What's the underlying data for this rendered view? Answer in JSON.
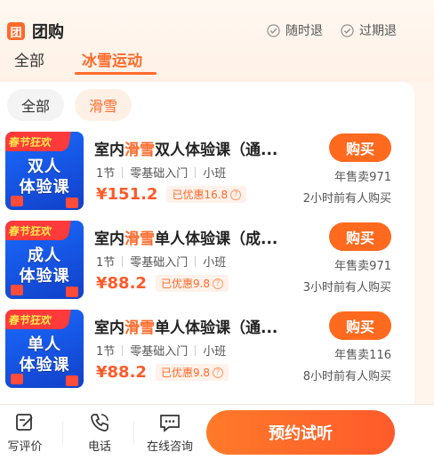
{
  "header": {
    "brand_logo": "团",
    "brand_title": "团购",
    "badges": [
      "随时退",
      "过期退"
    ]
  },
  "tabs": [
    {
      "label": "全部",
      "active": false
    },
    {
      "label": "冰雪运动",
      "active": true
    }
  ],
  "chips": [
    {
      "label": "全部",
      "active": false
    },
    {
      "label": "滑雪",
      "active": true
    }
  ],
  "products": [
    {
      "thumb_banner": "春节狂欢",
      "thumb_line1": "双人",
      "thumb_line2": "体验课",
      "title_pre": "室内",
      "title_hl": "滑雪",
      "title_post": "双人体验课（通...",
      "meta": [
        "1节",
        "零基础入门",
        "小班"
      ],
      "price": "¥151.2",
      "discount": "已优惠16.8",
      "buy_label": "购买",
      "sales": "年售卖971",
      "recent": "2小时前有人购买"
    },
    {
      "thumb_banner": "春节狂欢",
      "thumb_line1": "成人",
      "thumb_line2": "体验课",
      "title_pre": "室内",
      "title_hl": "滑雪",
      "title_post": "单人体验课（成...",
      "meta": [
        "1节",
        "零基础入门",
        "小班"
      ],
      "price": "¥88.2",
      "discount": "已优惠9.8",
      "buy_label": "购买",
      "sales": "年售卖971",
      "recent": "3小时前有人购买"
    },
    {
      "thumb_banner": "春节狂欢",
      "thumb_line1": "单人",
      "thumb_line2": "体验课",
      "title_pre": "室内",
      "title_hl": "滑雪",
      "title_post": "单人体验课（通...",
      "meta": [
        "1节",
        "零基础入门",
        "小班"
      ],
      "price": "¥88.2",
      "discount": "已优惠9.8",
      "buy_label": "购买",
      "sales": "年售卖116",
      "recent": "8小时前有人购买"
    }
  ],
  "bottom_bar": {
    "items": [
      {
        "label": "写评价",
        "icon": "edit-icon"
      },
      {
        "label": "电话",
        "icon": "phone-icon"
      },
      {
        "label": "在线咨询",
        "icon": "chat-icon"
      }
    ],
    "cta_label": "预约试听"
  },
  "colors": {
    "accent": "#ff6a2b",
    "price": "#ff5a2b",
    "thumb_blue": "#1b6bff",
    "banner_red": "#ff3a3a"
  }
}
